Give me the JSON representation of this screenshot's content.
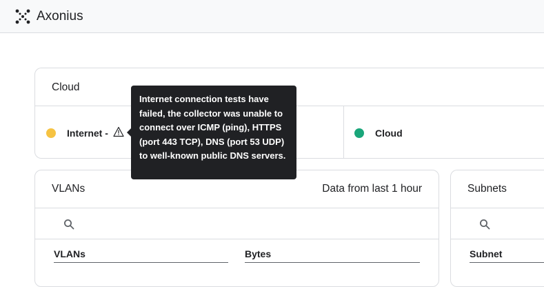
{
  "app": {
    "brand": "Axonius"
  },
  "cloud_panel": {
    "title": "Cloud",
    "statuses": [
      {
        "label": "Internet -",
        "color": "#f6c343",
        "icon": "warning-icon"
      },
      {
        "label": "Cloud",
        "color": "#1aa67a"
      }
    ]
  },
  "tooltip": {
    "text": "Internet connection tests have failed, the collector was unable to connect over ICMP (ping), HTTPS (port 443 TCP), DNS (port 53 UDP) to well-known public DNS servers."
  },
  "vlans_panel": {
    "title": "VLANs",
    "meta": "Data from last 1 hour",
    "columns": [
      "VLANs",
      "Bytes"
    ]
  },
  "subnets_panel": {
    "title": "Subnets",
    "columns": [
      "Subnet"
    ]
  }
}
